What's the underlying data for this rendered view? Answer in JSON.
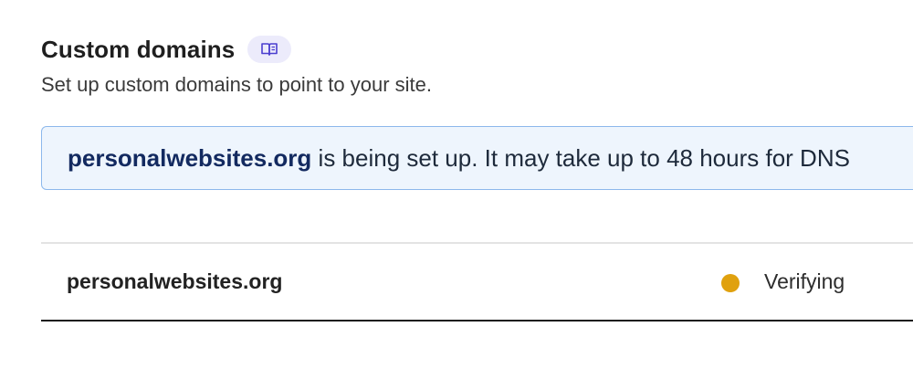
{
  "section": {
    "title": "Custom domains",
    "docs_icon": "book-icon",
    "subtitle": "Set up custom domains to point to your site."
  },
  "banner": {
    "domain": "personalwebsites.org",
    "message": " is being set up. It may take up to 48 hours for DNS"
  },
  "domains_list": {
    "rows": [
      {
        "domain": "personalwebsites.org",
        "status": "Verifying",
        "status_color": "#e0a10e"
      }
    ]
  },
  "colors": {
    "banner_background": "#eef5fd",
    "banner_border": "#8cb8ec",
    "docs_button_background": "#ecebfb",
    "docs_icon_color": "#4b3fcf"
  }
}
